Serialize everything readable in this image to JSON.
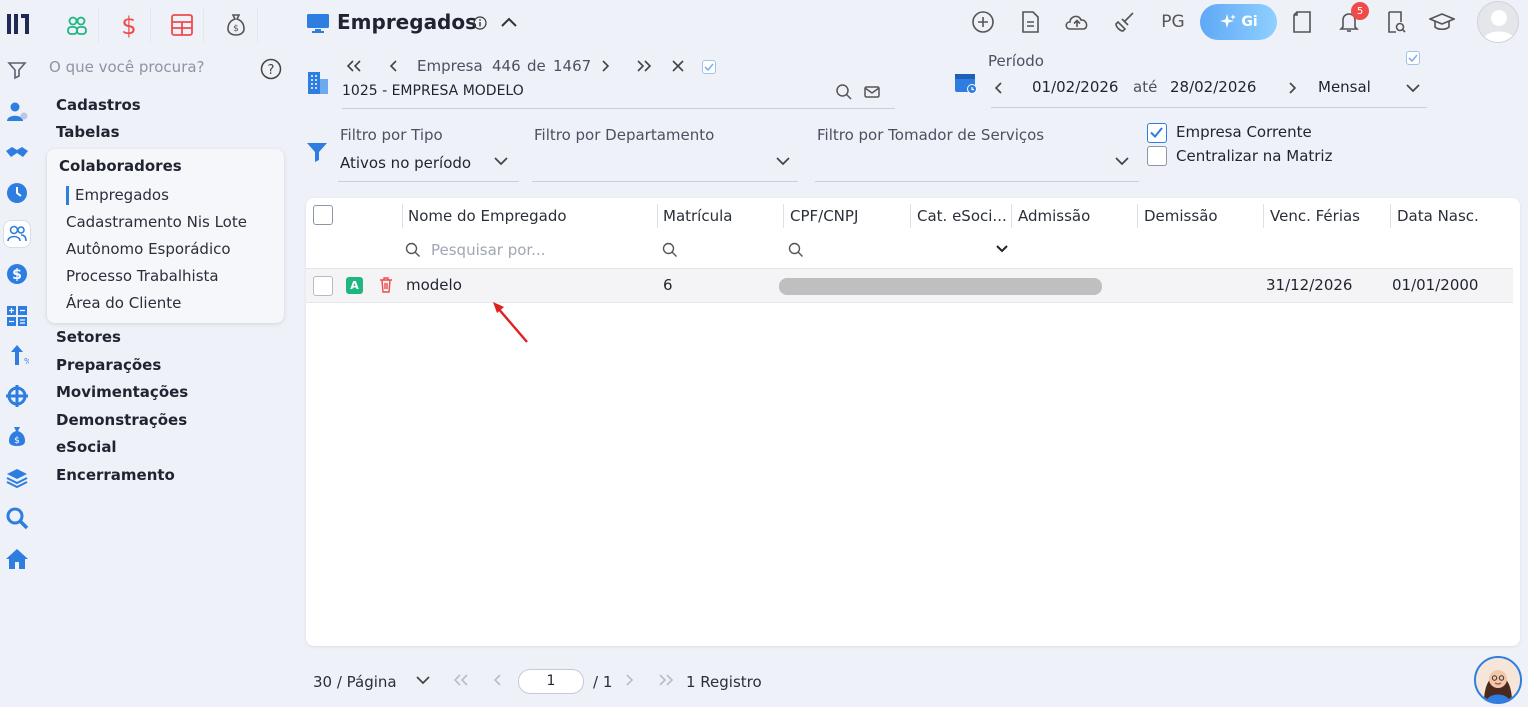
{
  "app": {
    "logo_icon": "brand-logo-icon",
    "module_tabs": [
      {
        "icon": "people-icon",
        "color": "#1fb680"
      },
      {
        "icon": "dollar-icon",
        "color": "#ef4b4b"
      },
      {
        "icon": "calculator-grid-icon",
        "color": "#ef4b4b"
      },
      {
        "icon": "money-bag-icon",
        "color": "#555555"
      }
    ]
  },
  "sidebar": {
    "search_placeholder": "O que você procura?",
    "menu": [
      "Cadastros",
      "Tabelas"
    ],
    "submenu": {
      "title": "Colaboradores",
      "items": [
        "Empregados",
        "Cadastramento Nis Lote",
        "Autônomo Esporádico",
        "Processo Trabalhista",
        "Área do Cliente"
      ]
    },
    "menu_after": [
      "Setores",
      "Preparações",
      "Movimentações",
      "Demonstrações",
      "eSocial",
      "Encerramento"
    ]
  },
  "header": {
    "title": "Empregados",
    "pg_label": "PG",
    "gi_label": "Gi",
    "notification_count": "5"
  },
  "company": {
    "label": "Empresa",
    "current": "446",
    "of_label": "de",
    "total": "1467",
    "name": "1025 - EMPRESA MODELO"
  },
  "period": {
    "label": "Período",
    "start": "01/02/2026",
    "until_label": "até",
    "end": "28/02/2026",
    "mode": "Mensal"
  },
  "filters": {
    "type_label": "Filtro por Tipo",
    "type_value": "Ativos no período",
    "department_label": "Filtro por Departamento",
    "taker_label": "Filtro por Tomador de Serviços",
    "current_company_label": "Empresa Corrente",
    "current_company_checked": true,
    "centralize_label": "Centralizar na Matriz",
    "centralize_checked": false
  },
  "table": {
    "columns": [
      "Nome do Empregado",
      "Matrícula",
      "CPF/CNPJ",
      "Cat. eSoci...",
      "Admissão",
      "Demissão",
      "Venc. Férias",
      "Data Nasc."
    ],
    "search_placeholder": "Pesquisar por...",
    "rows": [
      {
        "badge": "A",
        "name": "modelo",
        "matricula": "6",
        "venc_ferias": "31/12/2026",
        "data_nasc": "01/01/2000"
      }
    ]
  },
  "pagination": {
    "per_page": "30 / Página",
    "page": "1",
    "total_pages": "/ 1",
    "records": "1 Registro"
  },
  "colors": {
    "accent": "#2e7de0",
    "danger": "#ef4b4b",
    "success": "#1fb680"
  }
}
